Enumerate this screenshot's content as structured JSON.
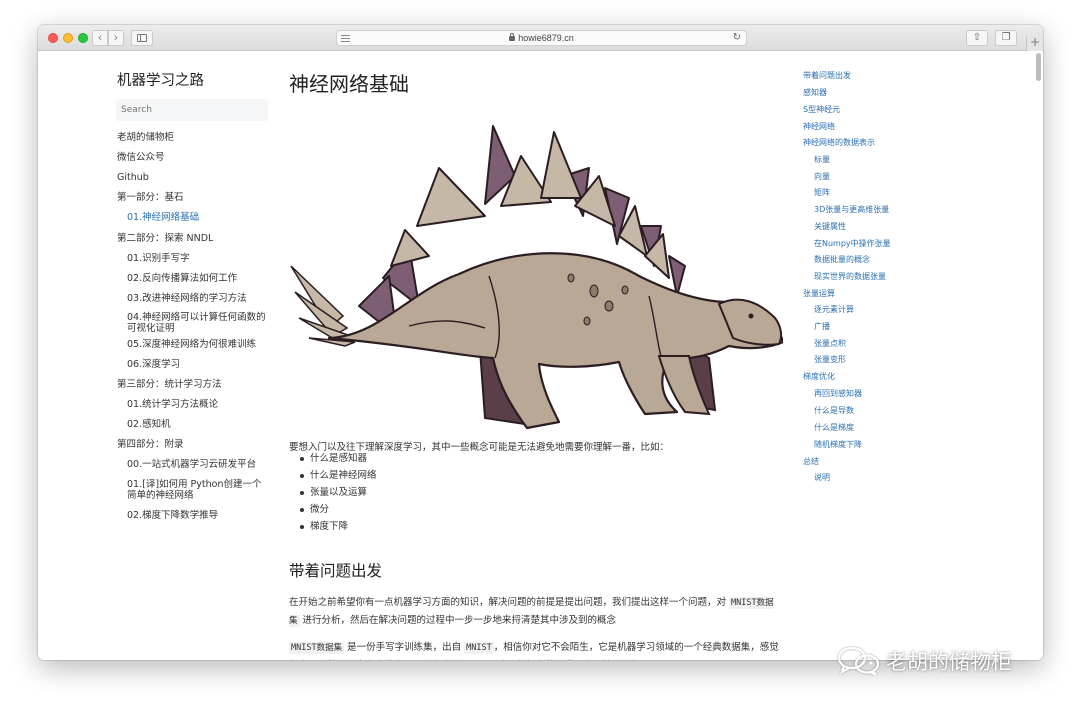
{
  "browser": {
    "url": "howie6879.cn"
  },
  "left_nav": {
    "site_title": "机器学习之路",
    "search_placeholder": "Search",
    "items": [
      {
        "label": "老胡的储物柜"
      },
      {
        "label": "微信公众号"
      },
      {
        "label": "Github"
      },
      {
        "label": "第一部分：基石"
      },
      {
        "label": "01.神经网络基础",
        "active": true
      },
      {
        "label": "第二部分：探索 NNDL"
      },
      {
        "label": "01.识别手写字"
      },
      {
        "label": "02.反向传播算法如何工作"
      },
      {
        "label": "03.改进神经网络的学习方法"
      },
      {
        "label": "04.神经网络可以计算任何函数的可视化证明"
      },
      {
        "label": "05.深度神经网络为何很难训练"
      },
      {
        "label": "06.深度学习"
      },
      {
        "label": "第三部分：统计学习方法"
      },
      {
        "label": "01.统计学习方法概论"
      },
      {
        "label": "02.感知机"
      },
      {
        "label": "第四部分：附录"
      },
      {
        "label": "00.一站式机器学习云研发平台"
      },
      {
        "label": "01.[译]如何用 Python创建一个简单的神经网络"
      },
      {
        "label": "02.梯度下降数学推导"
      }
    ]
  },
  "main": {
    "title": "神经网络基础",
    "intro": "要想入门以及往下理解深度学习，其中一些概念可能是无法避免地需要你理解一番，比如：",
    "bullets": [
      "什么是感知器",
      "什么是神经网络",
      "张量以及运算",
      "微分",
      "梯度下降"
    ],
    "section_title": "带着问题出发",
    "p1_a": "在开始之前希望你有一点机器学习方面的知识，解决问题的前提是提出问题，我们提出这样一个问题，对 ",
    "p1_code": "MNIST数据集",
    "p1_b": " 进行分析，然后在解决问题的过程中一步一步地来捋清楚其中涉及到的概念",
    "p2_code1": "MNIST数据集",
    "p2_a": " 是一份手写字训练集，出自 ",
    "p2_code2": "MNIST",
    "p2_b": "，相信你对它不会陌生，它是机器学习领域的一个经典数据集，感觉任意一个教程都拿它来说事，不过这也侧面证明了这个数据集的经典，这里简单介绍"
  },
  "toc": {
    "items": [
      {
        "label": "带着问题出发"
      },
      {
        "label": "感知器"
      },
      {
        "label": "S型神经元"
      },
      {
        "label": "神经网络"
      },
      {
        "label": "神经网络的数据表示"
      },
      {
        "label": "标量"
      },
      {
        "label": "向量"
      },
      {
        "label": "矩阵"
      },
      {
        "label": "3D张量与更高维张量"
      },
      {
        "label": "关键属性"
      },
      {
        "label": "在Numpy中操作张量"
      },
      {
        "label": "数据批量的概念"
      },
      {
        "label": "现实世界的数据张量"
      },
      {
        "label": "张量运算"
      },
      {
        "label": "逐元素计算"
      },
      {
        "label": "广播"
      },
      {
        "label": "张量点积"
      },
      {
        "label": "张量变形"
      },
      {
        "label": "梯度优化"
      },
      {
        "label": "再回到感知器"
      },
      {
        "label": "什么是导数"
      },
      {
        "label": "什么是梯度"
      },
      {
        "label": "随机梯度下降"
      },
      {
        "label": "总结"
      },
      {
        "label": "说明"
      }
    ]
  },
  "watermark": {
    "text": "老胡的储物柜",
    "icon": "wechat-icon"
  },
  "colors": {
    "link": "#2a6fb1",
    "dino_body": "#b9a895",
    "dino_plates": "#7d5e74"
  }
}
